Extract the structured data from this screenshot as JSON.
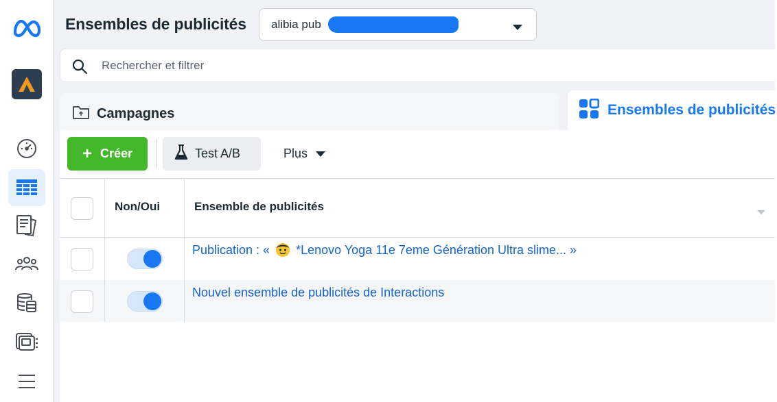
{
  "header": {
    "title": "Ensembles de publicités",
    "account_selector": {
      "value": "alibia pub",
      "dropdown_icon": "caret-down-icon"
    }
  },
  "search": {
    "placeholder": "Rechercher et filtrer",
    "value": ""
  },
  "tabs": {
    "campaigns": {
      "label": "Campagnes",
      "icon": "folder-icon"
    },
    "adsets": {
      "label": "Ensembles de publicités",
      "icon": "grid-icon"
    }
  },
  "toolbar": {
    "create_label": "Créer",
    "abtest_label": "Test A/B",
    "more_label": "Plus"
  },
  "table": {
    "columns": {
      "onoff": "Non/Oui",
      "name": "Ensemble de publicités"
    },
    "rows": [
      {
        "name_prefix": "Publication : «",
        "name_body": "*Lenovo Yoga 11e 7eme Génération Ultra slime... »",
        "enabled": true
      },
      {
        "name": "Nouvel ensemble de publicités de Interactions",
        "enabled": true
      }
    ]
  },
  "rail": {
    "items": [
      "meta-logo-icon",
      "brand-avatar-icon",
      "dashboard-gauge-icon",
      "table-grid-icon",
      "document-stack-icon",
      "people-group-icon",
      "database-stack-icon",
      "media-library-icon",
      "menu-hamburger-icon"
    ]
  },
  "colors": {
    "accent": "#1877f2",
    "create_button": "#42b72a",
    "link": "#1464cc"
  }
}
